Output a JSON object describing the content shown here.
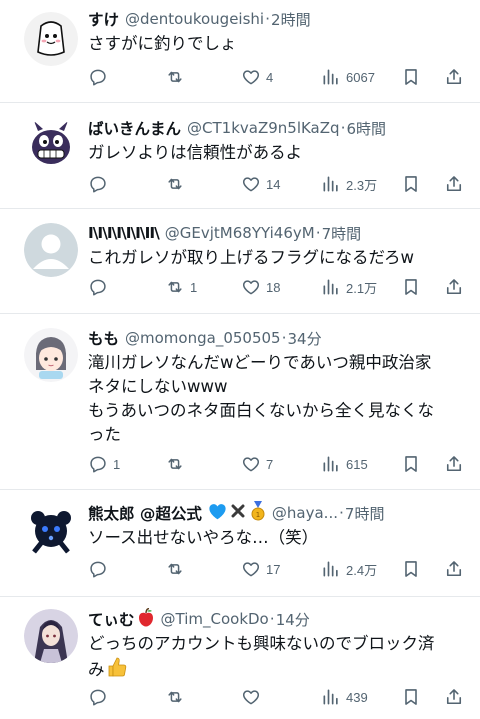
{
  "tweets": [
    {
      "name": "すけ",
      "handle": "@dentoukougeishi",
      "sep": "·",
      "time": "2時間",
      "text": "さすがに釣りでしょ",
      "replies": "",
      "retweets": "",
      "likes": "4",
      "views": "6067"
    },
    {
      "name": "ばいきんまん",
      "handle": "@CT1kvaZ9n5lKaZq",
      "sep": "·",
      "time": "6時間",
      "text": "ガレソよりは信頼性があるよ",
      "replies": "",
      "retweets": "",
      "likes": "14",
      "views": "2.3万"
    },
    {
      "name": "I\\I\\I\\I\\I\\I\\II\\",
      "handle": "@GEvjtM68YYi46yM",
      "sep": "·",
      "time": "7時間",
      "text": "これガレソが取り上げるフラグになるだろw",
      "replies": "",
      "retweets": "1",
      "likes": "18",
      "views": "2.1万"
    },
    {
      "name": "もも",
      "handle": "@momonga_050505",
      "sep": "·",
      "time": "34分",
      "text": "滝川ガレソなんだwどーりであいつ親中政治家\nネタにしないwww\nもうあいつのネタ面白くないから全く見なくな\nった",
      "replies": "1",
      "retweets": "",
      "likes": "7",
      "views": "615"
    },
    {
      "name": "熊太郎 @超公式",
      "handle": "@haya...",
      "sep": "·",
      "time": "7時間",
      "text": "ソース出せないやろな…（笑）",
      "replies": "",
      "retweets": "",
      "likes": "17",
      "views": "2.4万"
    },
    {
      "name": "てぃむ",
      "handle": "@Tim_CookDo",
      "sep": "·",
      "time": "14分",
      "text": "どっちのアカウントも興味ないのでブロック済\nみ",
      "replies": "",
      "retweets": "",
      "likes": "",
      "views": "439"
    }
  ],
  "icons": {
    "reply": "reply-icon",
    "retweet": "retweet-icon",
    "like": "heart-icon",
    "views": "views-icon",
    "bookmark": "bookmark-icon",
    "share": "share-icon"
  },
  "colors": {
    "text": "#0f1419",
    "secondary": "#536471",
    "divider": "#e6e9ec",
    "heart_emoji": "#1d9bf0",
    "apple_emoji": "#e0282e",
    "thumb_emoji": "#f7c13a"
  }
}
